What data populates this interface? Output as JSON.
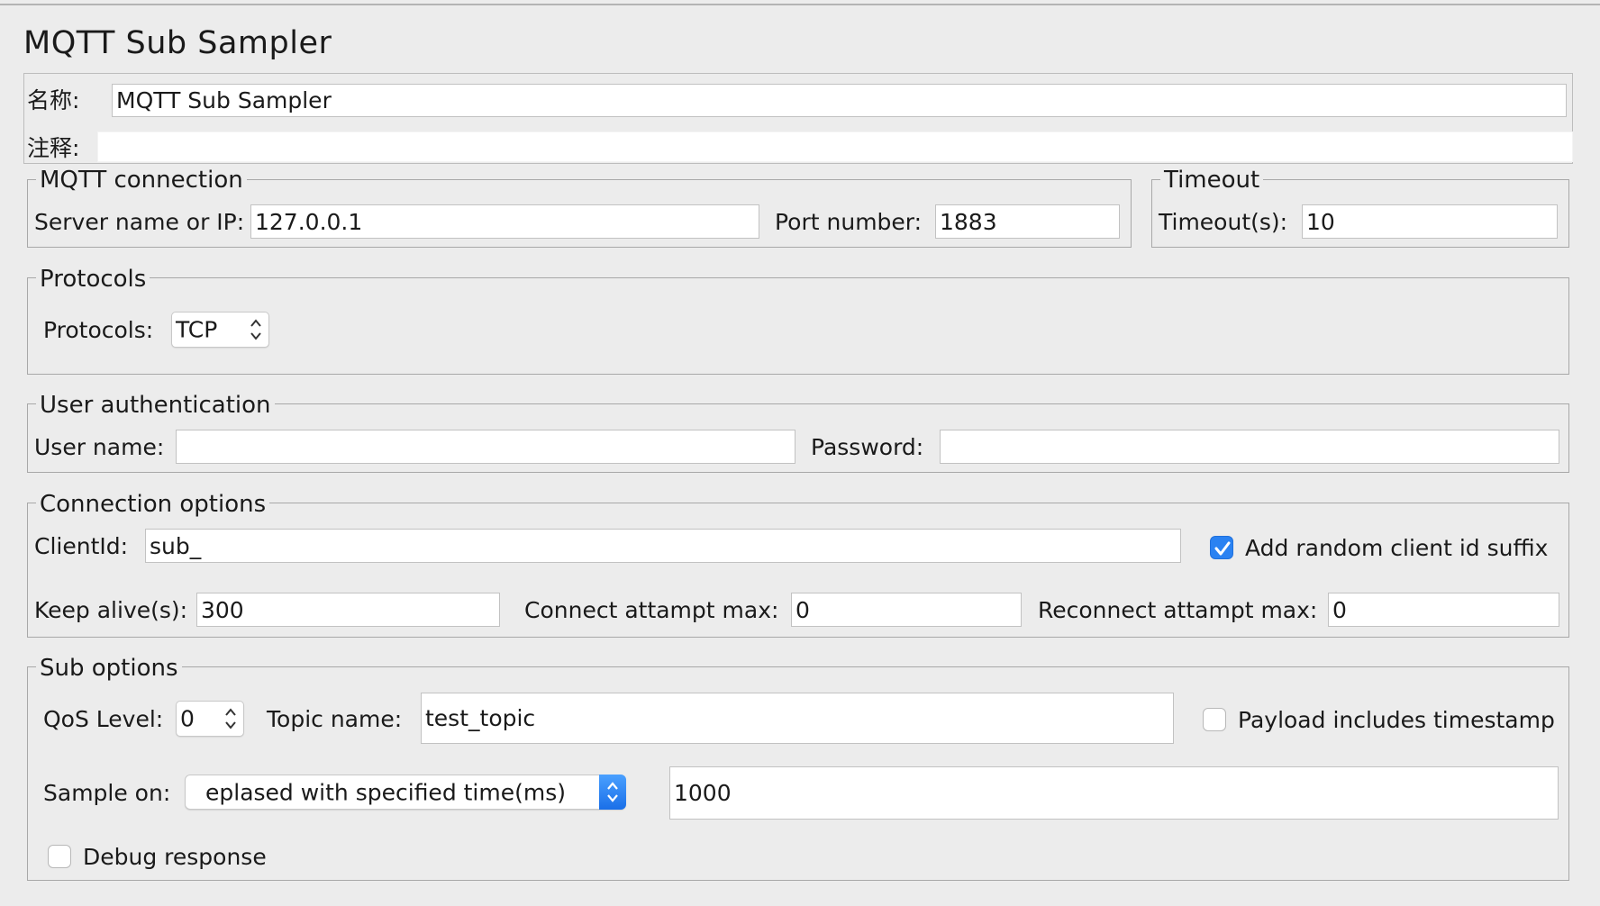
{
  "title": "MQTT Sub Sampler",
  "name_row": {
    "label": "名称:",
    "value": "MQTT Sub Sampler"
  },
  "comment_row": {
    "label": "注释:",
    "value": ""
  },
  "mqtt_connection": {
    "legend": "MQTT connection",
    "server_label": "Server name or IP:",
    "server_value": "127.0.0.1",
    "port_label": "Port number:",
    "port_value": "1883"
  },
  "timeout": {
    "legend": "Timeout",
    "label": "Timeout(s):",
    "value": "10"
  },
  "protocols": {
    "legend": "Protocols",
    "label": "Protocols:",
    "value": "TCP"
  },
  "user_auth": {
    "legend": "User authentication",
    "username_label": "User name:",
    "username_value": "",
    "password_label": "Password:",
    "password_value": ""
  },
  "connection_options": {
    "legend": "Connection options",
    "clientid_label": "ClientId:",
    "clientid_value": "sub_",
    "random_suffix_label": "Add random client id suffix",
    "random_suffix_checked": true,
    "keepalive_label": "Keep alive(s):",
    "keepalive_value": "300",
    "connect_max_label": "Connect attampt max:",
    "connect_max_value": "0",
    "reconnect_max_label": "Reconnect attampt max:",
    "reconnect_max_value": "0"
  },
  "sub_options": {
    "legend": "Sub options",
    "qos_label": "QoS Level:",
    "qos_value": "0",
    "topic_label": "Topic name:",
    "topic_value": "test_topic",
    "timestamp_label": "Payload includes timestamp",
    "timestamp_checked": false,
    "sample_on_label": "Sample on:",
    "sample_on_value": "eplased with specified time(ms)",
    "sample_value": "1000",
    "debug_label": "Debug response",
    "debug_checked": false
  },
  "colors": {
    "background": "#ececec",
    "border": "#a8a8a8",
    "checkbox_on": "#2a82f2"
  }
}
